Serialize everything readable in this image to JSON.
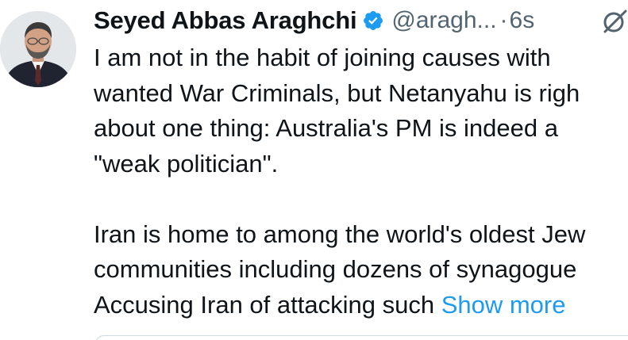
{
  "tweet": {
    "display_name": "Seyed Abbas Araghchi",
    "handle": "@aragh...",
    "separator": "·",
    "time": "6s",
    "lines": [
      "I am not in the habit of joining causes with",
      "wanted War Criminals, but Netanyahu is righ",
      "about one thing: Australia's PM is indeed a",
      "\"weak politician\".",
      "Iran is home to among the world's oldest Jew",
      "communities including dozens of synagogue",
      "Accusing Iran of attacking such "
    ],
    "show_more": "Show more"
  },
  "icons": {
    "verified": "verified-badge-icon",
    "grok": "grok-icon"
  },
  "colors": {
    "text": "#0f1419",
    "secondary": "#536471",
    "link": "#1d9bf0",
    "verified": "#1d9bf0"
  }
}
